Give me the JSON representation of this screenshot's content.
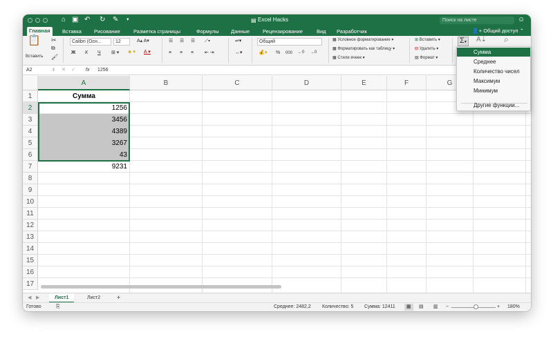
{
  "window": {
    "title": "Excel Hacks",
    "search_placeholder": "Поиск на листе"
  },
  "ribbon_tabs": [
    "Главная",
    "Вставка",
    "Рисование",
    "Разметка страницы",
    "Формулы",
    "Данные",
    "Рецензирование",
    "Вид",
    "Разработчик"
  ],
  "share_label": "Общий доступ",
  "ribbon": {
    "paste_label": "Вставить",
    "font_name": "Calibri (Осн...",
    "font_size": "12",
    "bold": "Ж",
    "italic": "К",
    "underline": "Ч",
    "number_format": "Общий",
    "percent": "%",
    "thousands": "000",
    "cond_format": "Условное форматирование",
    "format_table": "Форматировать как таблицу",
    "cell_styles": "Стили ячеек",
    "insert": "Вставить",
    "delete": "Удалить",
    "format": "Формат",
    "sigma": "Σ"
  },
  "formula_bar": {
    "name_box": "A2",
    "fx": "fx",
    "value": "1256"
  },
  "columns": [
    "A",
    "B",
    "C",
    "D",
    "E",
    "F",
    "G"
  ],
  "rows": [
    "1",
    "2",
    "3",
    "4",
    "5",
    "6",
    "7",
    "8",
    "9",
    "10",
    "11",
    "12",
    "13",
    "14",
    "15",
    "16",
    "17"
  ],
  "cells": {
    "a1": "Сумма",
    "a2": "1256",
    "a3": "3456",
    "a4": "4389",
    "a5": "3267",
    "a6": "43",
    "a7": "9231"
  },
  "autosum_menu": {
    "items": [
      "Сумма",
      "Среднее",
      "Количество чисел",
      "Максимум",
      "Минимум"
    ],
    "more": "Другие функции..."
  },
  "sheets": [
    "Лист1",
    "Лист2"
  ],
  "add_sheet": "+",
  "status": {
    "ready": "Готово",
    "average": "Среднее: 2482,2",
    "count": "Количество: 5",
    "sum": "Сумма: 12411",
    "zoom": "180%",
    "zoom_minus": "−",
    "zoom_plus": "+"
  },
  "colors": {
    "accent": "#1e7145",
    "selection_fill": "#c6c6c6"
  }
}
